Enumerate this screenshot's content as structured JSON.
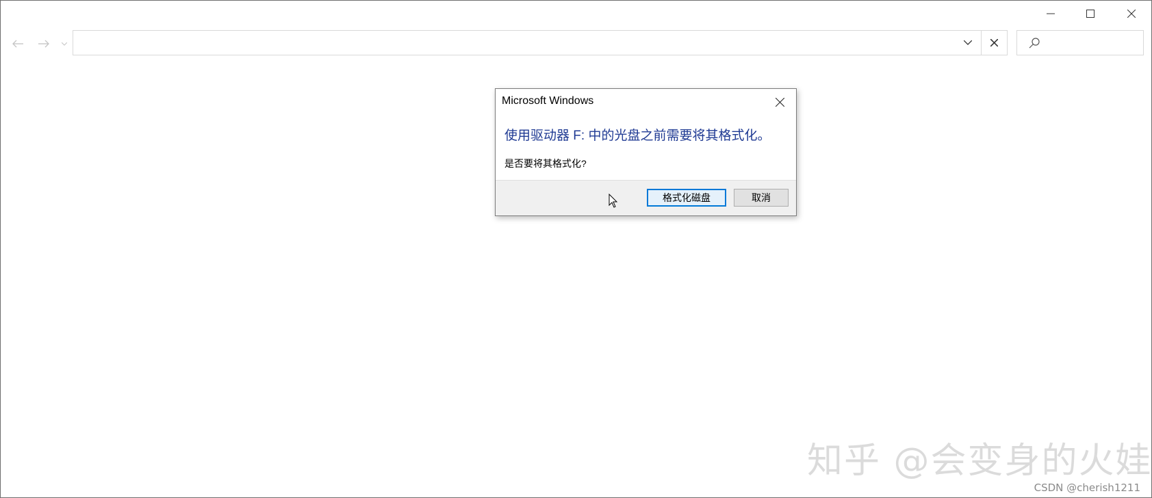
{
  "window": {
    "caption_buttons": {
      "minimize": "minimize-icon",
      "maximize": "maximize-icon",
      "close": "close-icon"
    },
    "navigation": {
      "back": "arrow-left-icon",
      "forward": "arrow-right-icon",
      "recent": "chevron-down-icon"
    },
    "address_bar": {
      "value": "",
      "dropdown_icon": "chevron-down-icon",
      "clear_icon": "close-icon"
    },
    "search": {
      "value": "",
      "icon": "search-icon"
    }
  },
  "dialog": {
    "title": "Microsoft Windows",
    "heading": "使用驱动器 F: 中的光盘之前需要将其格式化。",
    "question": "是否要将其格式化?",
    "primary_button": "格式化磁盘",
    "cancel_button": "取消",
    "heading_color": "#1f3a93"
  },
  "overlay": {
    "watermark": "知乎 @会变身的火娃",
    "credit": "CSDN @cherish1211"
  }
}
